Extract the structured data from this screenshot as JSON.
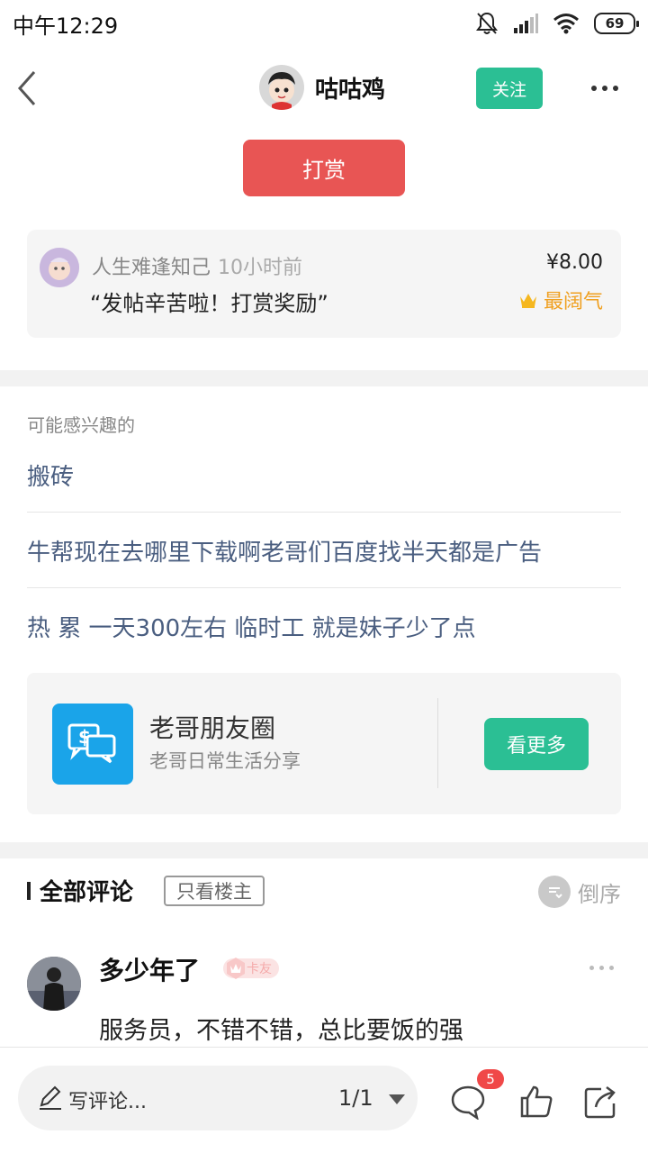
{
  "status_bar": {
    "time": "中午12:29",
    "battery": "69"
  },
  "header": {
    "author_name": "咕咕鸡",
    "follow_label": "关注"
  },
  "tip": {
    "button_label": "打赏",
    "record": {
      "user": "人生难逢知己",
      "time": "10小时前",
      "message": "“发帖辛苦啦！打赏奖励”",
      "amount": "¥8.00",
      "badge": "最阔气"
    }
  },
  "recommended": {
    "title": "可能感兴趣的",
    "items": [
      "搬砖",
      "牛帮现在去哪里下载啊老哥们百度找半天都是广告",
      "热 累 一天300左右 临时工 就是妹子少了点"
    ],
    "circle": {
      "name": "老哥朋友圈",
      "desc": "老哥日常生活分享",
      "button_label": "看更多"
    }
  },
  "comments": {
    "title": "全部评论",
    "filter_label": "只看楼主",
    "sort_label": "倒序",
    "items": [
      {
        "author": "多少年了",
        "badge": "卡友",
        "text": "服务员，不错不错，总比要饭的强"
      }
    ]
  },
  "bottom_bar": {
    "input_placeholder": "写评论...",
    "page_indicator": "1/1",
    "comment_count": "5"
  },
  "colors": {
    "accent_green": "#2bbf94",
    "tip_red": "#e85554",
    "link_blue": "#4a5e80",
    "gold": "#f0a020"
  }
}
